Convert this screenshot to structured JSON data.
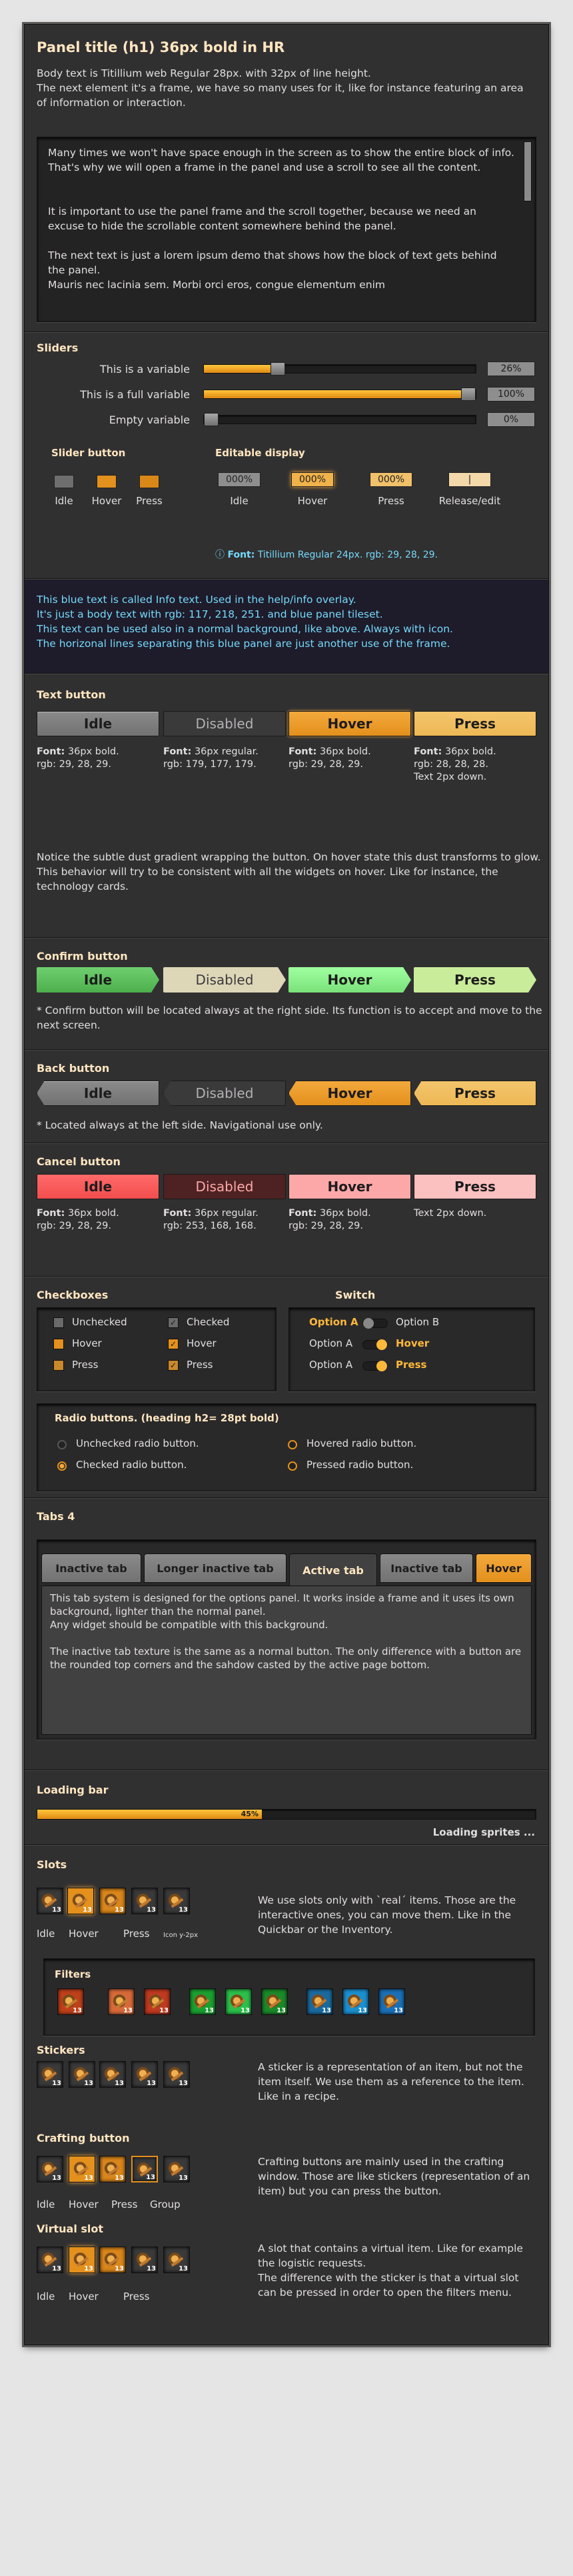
{
  "header": {
    "title": "Panel title (h1) 36px bold in HR",
    "intro": "Body text is Titillium web Regular 28px. with 32px of line height.\nThe next element it's a frame, we have so many uses for it, like for instance featuring an area of information or interaction."
  },
  "frame_text": {
    "p1": "Many times we won't have space enough in the screen as to show the entire block of info. That's why we will open a frame in the panel and use a scroll to see all the content.",
    "p2": "It is important to use the panel frame and the scroll together, because we need an excuse to hide the scrollable content somewhere behind the panel.",
    "p3": "The next text is just a lorem ipsum demo that shows how the block of text gets behind the panel.\nMauris nec lacinia sem. Morbi orci eros, congue elementum enim"
  },
  "sliders": {
    "title": "Sliders",
    "rows": [
      {
        "label": "This is a variable",
        "value": "26%",
        "pct": 0.26
      },
      {
        "label": "This is a full variable",
        "value": "100%",
        "pct": 1.0
      },
      {
        "label": "Empty variable",
        "value": "0%",
        "pct": 0
      }
    ]
  },
  "slider_button": {
    "title": "Slider button",
    "labels": [
      "Idle",
      "Hover",
      "Press"
    ]
  },
  "editable": {
    "title": "Editable display",
    "values": [
      "000%",
      "000%",
      "000%",
      "|"
    ],
    "labels": [
      "Idle",
      "Hover",
      "Press",
      "Release/edit"
    ],
    "font_label": "Font:",
    "font_text": "Titillium Regular 24px. rgb: 29, 28, 29."
  },
  "info": {
    "text": "This blue text is called Info text. Used in the help/info overlay.\nIt's just a body text with rgb: 117, 218, 251. and blue panel tileset.\nThis text can be used also in a normal background, like above. Always with icon.\nThe horizonal lines separating this blue panel are just another use of the frame.",
    "color": "#75dafb"
  },
  "text_button": {
    "title": "Text button",
    "buttons": [
      "Idle",
      "Disabled",
      "Hover",
      "Press"
    ],
    "notes": [
      {
        "b": "Font:",
        "t": " 36px bold.\nrgb: 29, 28, 29."
      },
      {
        "b": "Font:",
        "t": " 36px regular.\nrgb: 179, 177, 179."
      },
      {
        "b": "Font:",
        "t": " 36px bold.\nrgb: 29, 28, 29."
      },
      {
        "b": "Font:",
        "t": " 36px bold.\nrgb: 28, 28, 28.\nText 2px down."
      }
    ],
    "desc": "Notice the subtle dust gradient wrapping the button. On hover state this dust transforms to glow. This behavior will try to be consistent with all the widgets on hover. Like for instance, the technology cards."
  },
  "confirm": {
    "title": "Confirm button",
    "buttons": [
      "Idle",
      "Disabled",
      "Hover",
      "Press"
    ],
    "desc": "* Confirm button will be located always at the right side. Its function is to accept and move to the next screen."
  },
  "back": {
    "title": "Back button",
    "buttons": [
      "Idle",
      "Disabled",
      "Hover",
      "Press"
    ],
    "desc": "* Located always at the left side. Navigational use only."
  },
  "cancel": {
    "title": "Cancel button",
    "buttons": [
      "Idle",
      "Disabled",
      "Hover",
      "Press"
    ],
    "notes": [
      {
        "b": "Font:",
        "t": " 36px bold.\nrgb: 29, 28, 29."
      },
      {
        "b": "Font:",
        "t": " 36px regular.\nrgb: 253, 168, 168."
      },
      {
        "b": "Font:",
        "t": " 36px bold.\nrgb: 29, 28, 29."
      },
      {
        "b": "",
        "t": "Text 2px down."
      }
    ]
  },
  "checkboxes": {
    "title": "Checkboxes",
    "items": [
      "Unchecked",
      "Hover",
      "Press"
    ],
    "items2": [
      "Checked",
      "Hover",
      "Press"
    ]
  },
  "switch": {
    "title": "Switch",
    "rows": [
      {
        "a": "Option A",
        "b": "Option B"
      },
      {
        "a": "Option A",
        "b": "Hover"
      },
      {
        "a": "Option A",
        "b": "Press"
      }
    ]
  },
  "radio": {
    "title": "Radio buttons. (heading h2= 28pt  bold)",
    "items": [
      "Unchecked radio button.",
      "Checked radio button.",
      "Hovered radio button.",
      "Pressed radio button."
    ]
  },
  "tabs": {
    "title": "Tabs 4",
    "tabs": [
      "Inactive tab",
      "Longer inactive tab",
      "Active tab",
      "Inactive tab",
      "Hover"
    ],
    "text": "This tab system is designed for the options panel. It works inside a frame and it uses its own background, lighter than the normal panel.\nAny widget should be compatible with this background.\n\nThe inactive tab texture is the same as a normal button. The only difference with a button are the rounded top corners and the sahdow casted by the active page bottom."
  },
  "loading": {
    "title": "Loading bar",
    "pct_label": "45%",
    "progress": 0.45,
    "status": "Loading sprites ..."
  },
  "slots": {
    "title": "Slots",
    "labels": [
      "Idle",
      "Hover",
      "Press"
    ],
    "icon_note": "Icon y-2px",
    "count": "13",
    "desc": "We use slots only with `real´ items. Those are the interactive ones, you can move them. Like in the Quickbar or the Inventory."
  },
  "filters": {
    "title": "Filters"
  },
  "stickers": {
    "title": "Stickers",
    "desc": "A sticker is a representation of an item, but not the item itself. We use them as a reference to the item. Like in a recipe."
  },
  "crafting": {
    "title": "Crafting button",
    "labels": [
      "Idle",
      "Hover",
      "Press",
      "Group"
    ],
    "desc": "Crafting buttons are mainly used in the crafting  window. Those are like stickers (representation of an item) but you can press the button."
  },
  "virtual": {
    "title": "Virtual slot",
    "labels": [
      "Idle",
      "Hover",
      "Press"
    ],
    "desc": "A slot that contains a virtual item. Like for example the logistic requests.\nThe difference with the sticker is that a virtual slot can be pressed in order to open the filters menu."
  }
}
